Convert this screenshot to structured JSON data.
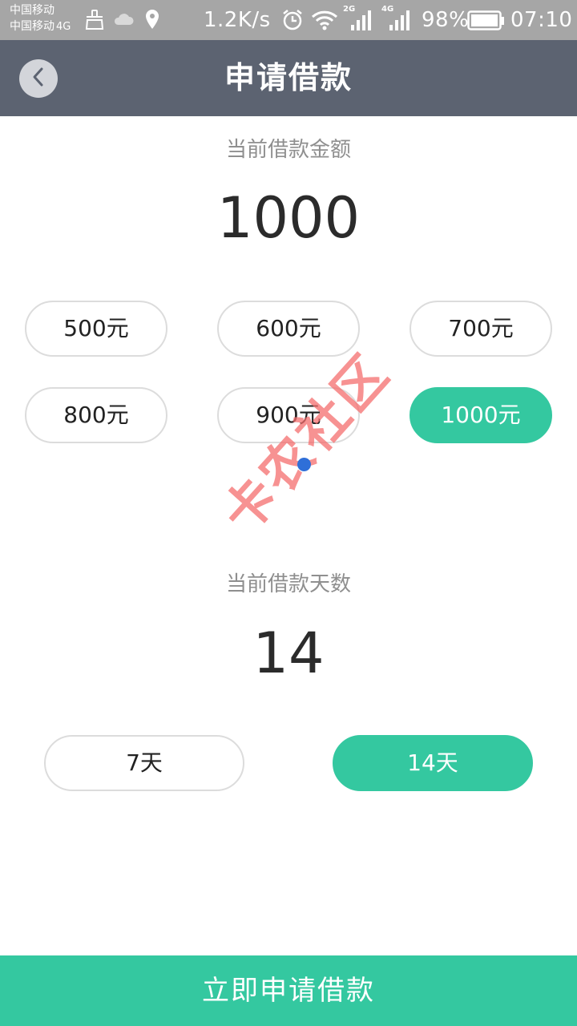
{
  "status_bar": {
    "carrier_1": "中国移动",
    "carrier_2": "中国移动",
    "carrier_2_network": "4G",
    "net_speed": "1.2K/s",
    "signal_1_type": "2G",
    "signal_2_type": "4G",
    "battery_percent": "98%",
    "time": "07:10",
    "icons": [
      "broom-icon",
      "cloud-icon",
      "location-pin-icon",
      "alarm-clock-icon",
      "wifi-icon",
      "signal-icon",
      "signal-icon",
      "battery-icon"
    ]
  },
  "header": {
    "title": "申请借款",
    "back_icon": "chevron-left-icon"
  },
  "amount": {
    "label": "当前借款金额",
    "value": "1000",
    "options": [
      {
        "label": "500元",
        "selected": false
      },
      {
        "label": "600元",
        "selected": false
      },
      {
        "label": "700元",
        "selected": false
      },
      {
        "label": "800元",
        "selected": false
      },
      {
        "label": "900元",
        "selected": false
      },
      {
        "label": "1000元",
        "selected": true
      }
    ]
  },
  "days": {
    "label": "当前借款天数",
    "value": "14",
    "options": [
      {
        "label": "7天",
        "selected": false
      },
      {
        "label": "14天",
        "selected": true
      }
    ]
  },
  "watermark": "卡农社区",
  "submit_label": "立即申请借款",
  "colors": {
    "accent": "#34c8a0",
    "header": "#5c6371",
    "status_bar": "#a6a6a6"
  }
}
